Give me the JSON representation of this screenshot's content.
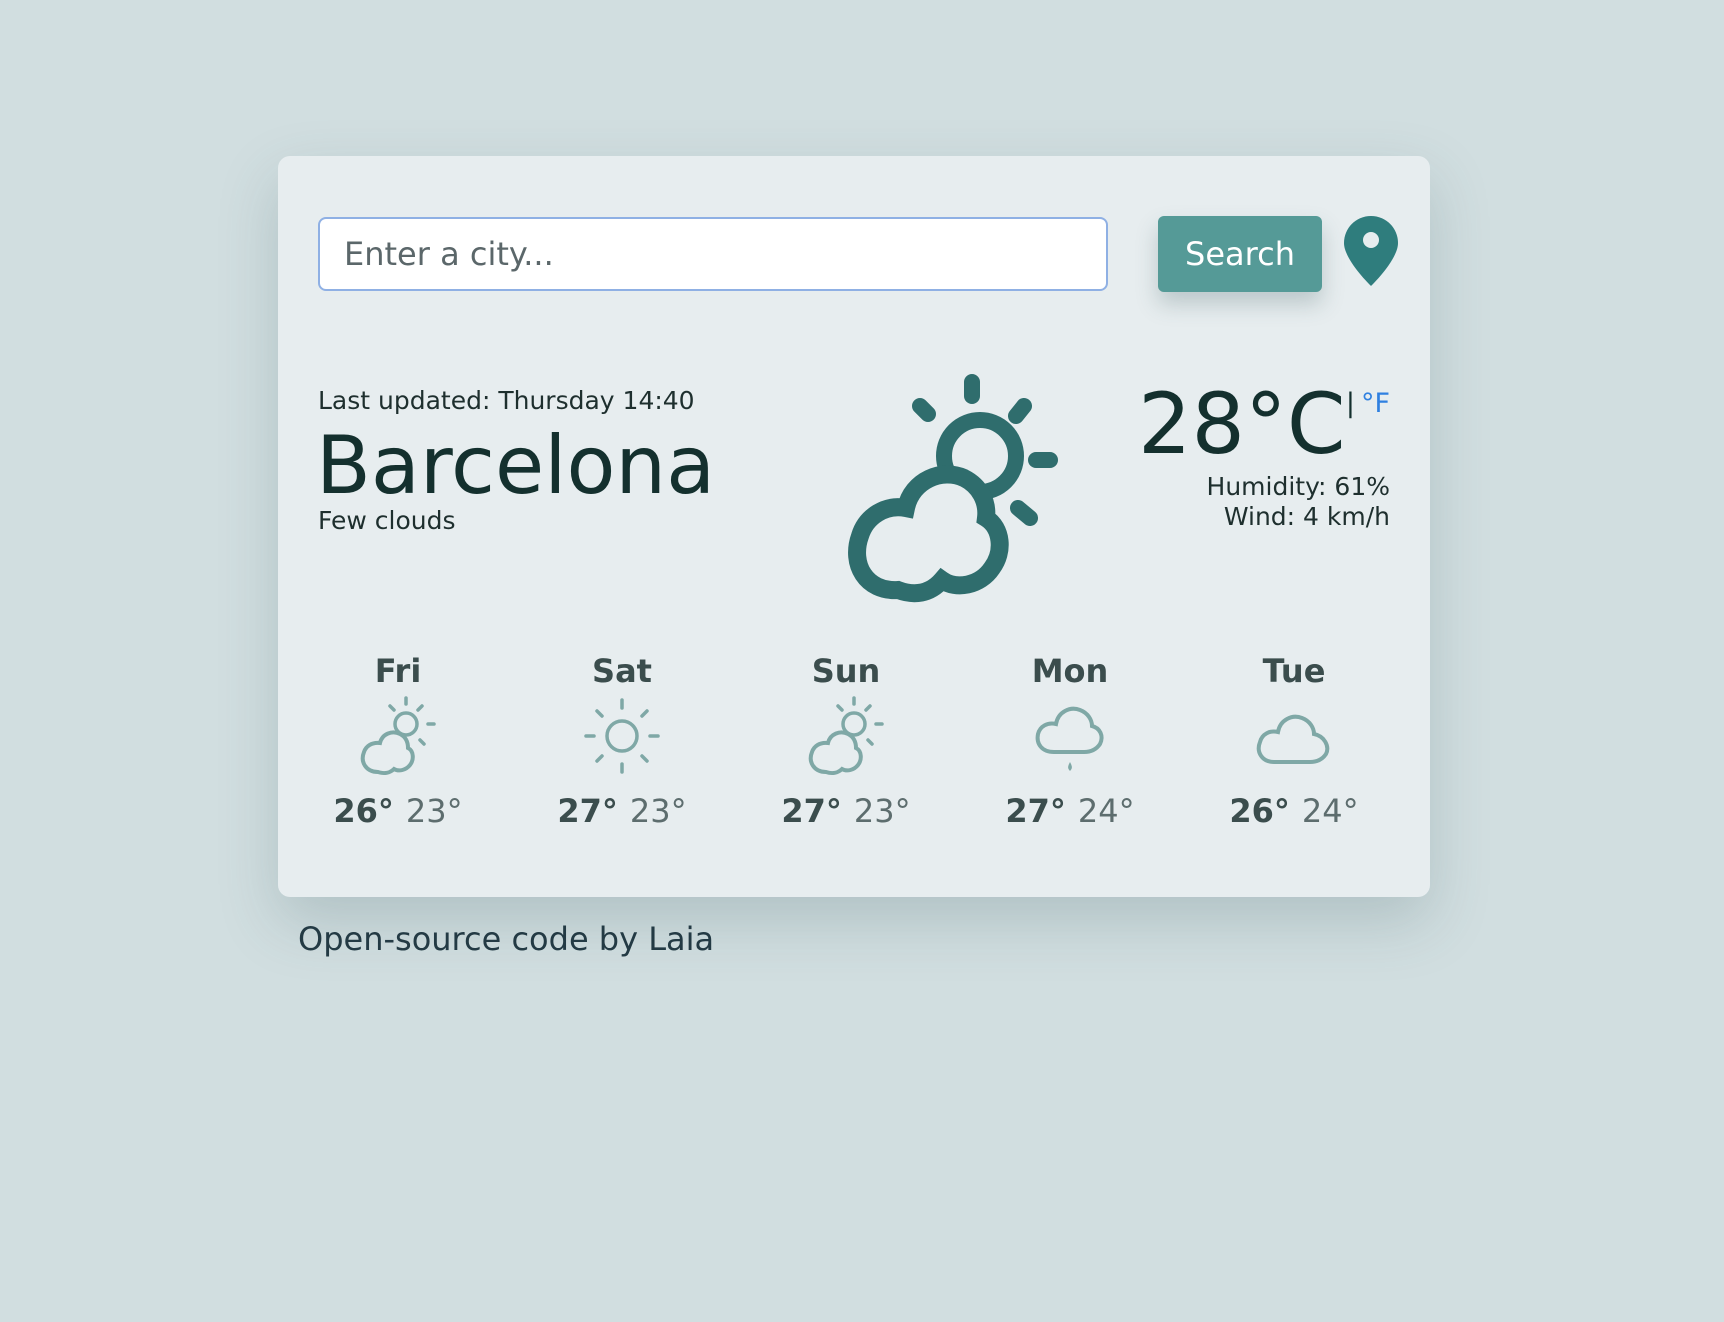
{
  "search": {
    "placeholder": "Enter a city...",
    "value": "",
    "button_label": "Search"
  },
  "icons": {
    "location": "map-pin-icon",
    "current_weather": "partly-cloudy-icon"
  },
  "current": {
    "last_updated": "Last updated: Thursday 14:40",
    "city": "Barcelona",
    "condition": "Few clouds",
    "temperature": "28°C",
    "unit_separator": "|",
    "unit_alt": "°F",
    "humidity": "Humidity: 61%",
    "wind": "Wind: 4 km/h"
  },
  "forecast": [
    {
      "day": "Fri",
      "icon": "partly-cloudy-icon",
      "max": "26°",
      "min": "23°"
    },
    {
      "day": "Sat",
      "icon": "sun-icon",
      "max": "27°",
      "min": "23°"
    },
    {
      "day": "Sun",
      "icon": "partly-cloudy-icon",
      "max": "27°",
      "min": "23°"
    },
    {
      "day": "Mon",
      "icon": "rain-cloud-icon",
      "max": "27°",
      "min": "24°"
    },
    {
      "day": "Tue",
      "icon": "cloud-icon",
      "max": "26°",
      "min": "24°"
    }
  ],
  "footer": {
    "text": "Open-source code by Laia"
  },
  "colors": {
    "background": "#d1dee0",
    "card": "#e7edef",
    "accent": "#559a97",
    "icon_main": "#2f6d6d",
    "icon_small": "#7fa8a6",
    "link_blue": "#2f80e0"
  }
}
